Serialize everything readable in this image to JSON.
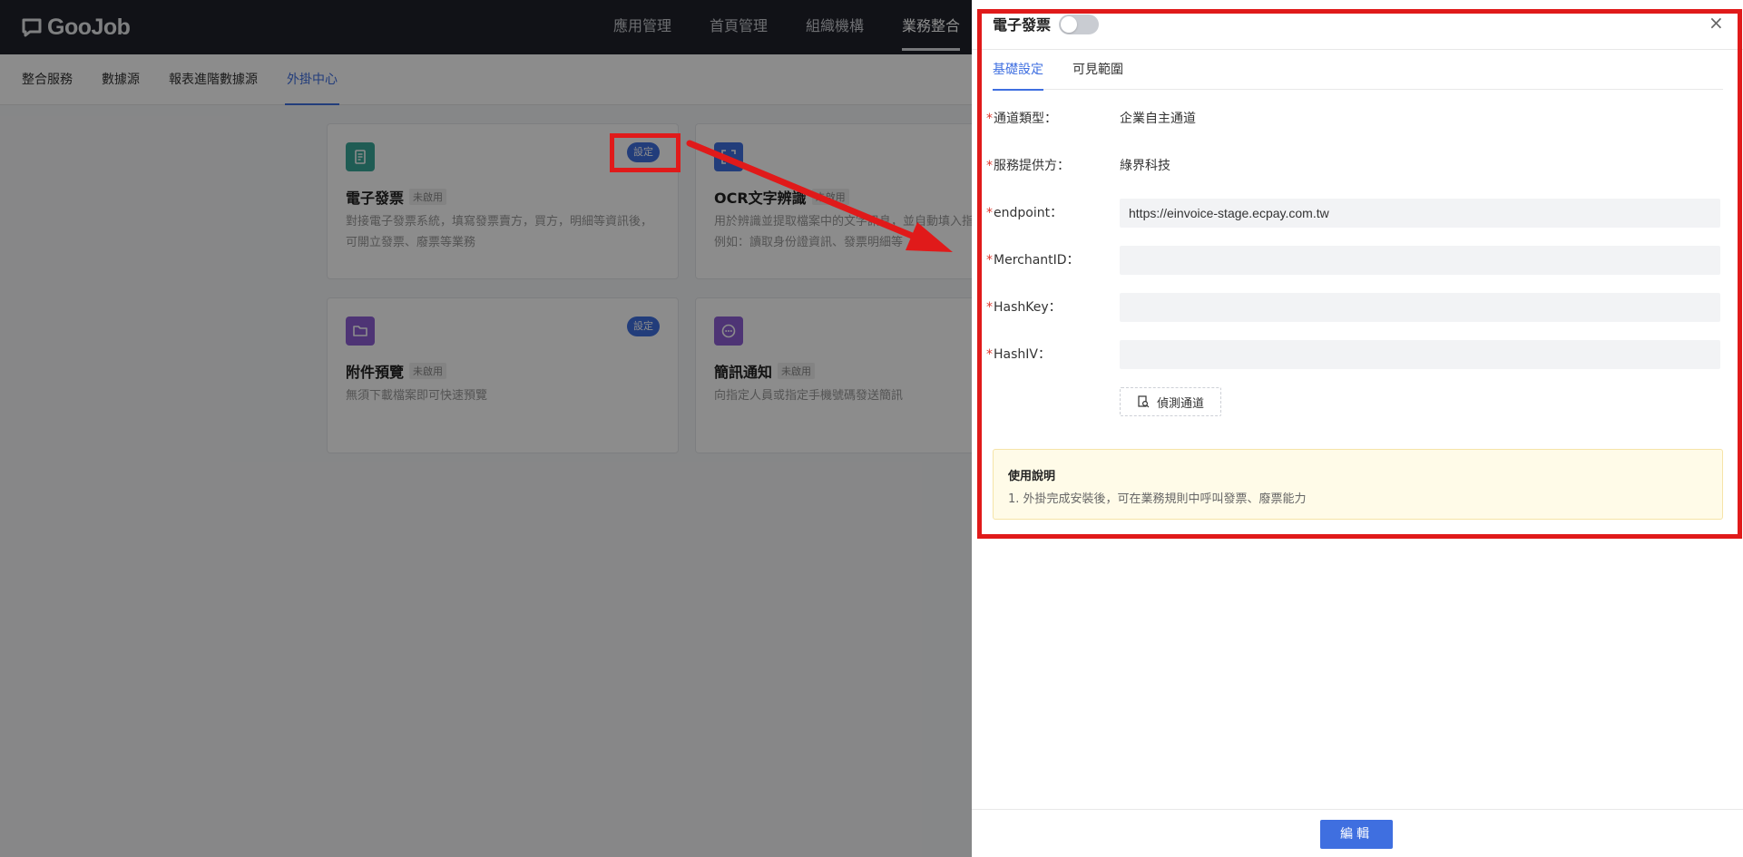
{
  "app": {
    "logo_text": "GooJob"
  },
  "topnav": {
    "items": [
      "應用管理",
      "首頁管理",
      "組織機構",
      "業務整合"
    ]
  },
  "subnav": {
    "items": [
      "整合服務",
      "數據源",
      "報表進階數據源",
      "外掛中心"
    ]
  },
  "cards": [
    {
      "title": "電子發票",
      "tag": "未啟用",
      "desc": "對接電子發票系統，填寫發票賣方，買方，明細等資訊後，可開立發票、廢票等業務",
      "button": "設定",
      "icon": "receipt-icon"
    },
    {
      "title": "OCR文字辨識",
      "tag": "未啟用",
      "desc": "用於辨識並提取檔案中的文字訊息，並自動填入指定欄位，例如：讀取身份證資訊、發票明細等",
      "icon": "scan-icon"
    },
    {
      "title": "附件預覽",
      "tag": "未啟用",
      "desc": "無須下載檔案即可快速預覽",
      "button": "設定",
      "icon": "folder-icon"
    },
    {
      "title": "簡訊通知",
      "tag": "未啟用",
      "desc": "向指定人員或指定手機號碼發送簡訊",
      "icon": "chat-icon"
    }
  ],
  "drawer": {
    "title": "電子發票",
    "close_icon": "×",
    "tabs": [
      "基礎設定",
      "可見範圍"
    ],
    "fields": [
      {
        "label": "通道類型：",
        "value": "企業自主通道"
      },
      {
        "label": "服務提供方：",
        "value": "綠界科技"
      },
      {
        "label": "endpoint：",
        "value": "https://einvoice-stage.ecpay.com.tw"
      },
      {
        "label": "MerchantID：",
        "value": ""
      },
      {
        "label": "HashKey：",
        "value": ""
      },
      {
        "label": "HashIV：",
        "value": ""
      }
    ],
    "test_button": "偵測通道",
    "note": {
      "title": "使用說明",
      "text": "1. 外掛完成安裝後，可在業務規則中呼叫發票、廢票能力"
    },
    "edit_button": "編輯"
  },
  "colors": {
    "accent": "#3f6fe0",
    "highlight": "#e01a1a",
    "topbar": "#1f222b"
  }
}
